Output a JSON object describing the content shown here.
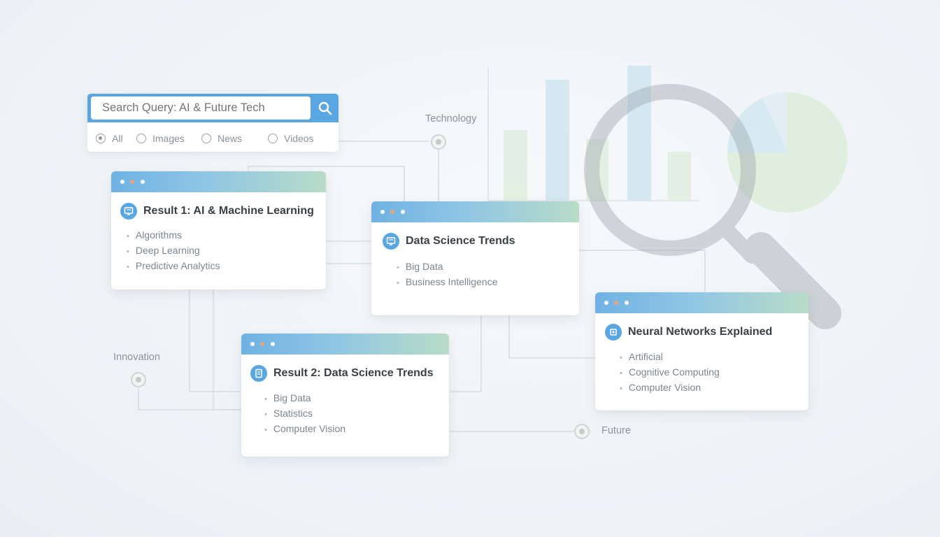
{
  "search": {
    "placeholder": "Search Query: AI & Future Tech",
    "button_icon": "search-icon",
    "filters": [
      {
        "label": "All",
        "checked": true
      },
      {
        "label": "Images",
        "checked": false
      },
      {
        "label": "News",
        "checked": false
      },
      {
        "label": "Videos",
        "checked": false
      }
    ]
  },
  "nodes": {
    "technology": "Technology",
    "innovation": "Innovation",
    "future": "Future"
  },
  "cards": [
    {
      "title": "Result 1: AI & Machine Learning",
      "icon": "screen-icon",
      "items": [
        "Algorithms",
        "Deep Learning",
        "Predictive Analytics"
      ]
    },
    {
      "title": "Data Science Trends",
      "icon": "screen-icon",
      "items": [
        "Big Data",
        "Business Intelligence"
      ]
    },
    {
      "title": "Result 2: Data Science Trends",
      "icon": "document-icon",
      "items": [
        "Big Data",
        "Statistics",
        "Computer Vision"
      ]
    },
    {
      "title": "Neural Networks Explained",
      "icon": "chip-icon",
      "items": [
        "Artificial",
        "Cognitive Computing",
        "Computer Vision"
      ]
    }
  ],
  "colors": {
    "accent": "#5aa6e0",
    "header_end": "#b8dcc8",
    "dot_orange": "#f0a37a"
  }
}
